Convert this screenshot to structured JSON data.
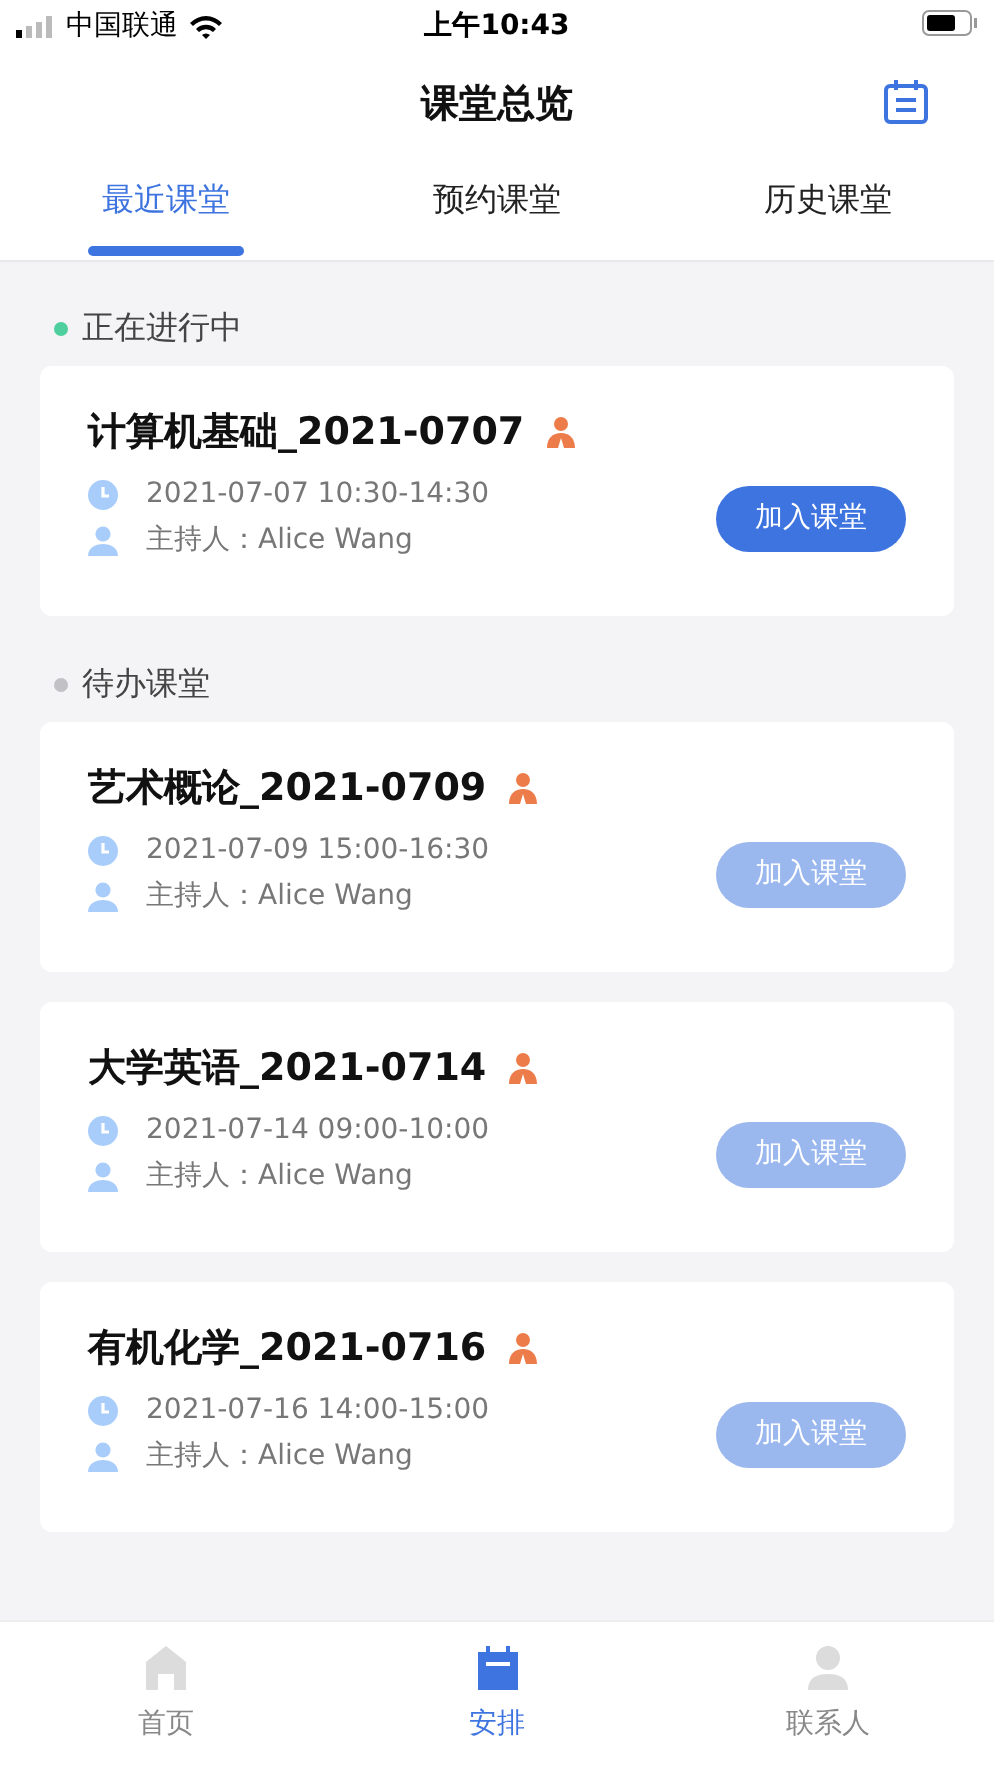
{
  "status_bar": {
    "carrier": "中国联通",
    "time": "上午10:43"
  },
  "header": {
    "title": "课堂总览"
  },
  "tabs": [
    {
      "label": "最近课堂",
      "selected": true
    },
    {
      "label": "预约课堂",
      "selected": false
    },
    {
      "label": "历史课堂",
      "selected": false
    }
  ],
  "sections": [
    {
      "title": "正在进行中",
      "color": "#4fcf9e",
      "classes": [
        {
          "name": "计算机基础_2021-0707",
          "time": "2021-07-07 10:30-14:30",
          "host": "主持人：Alice Wang",
          "button": "加入课堂",
          "disabled": false
        }
      ]
    },
    {
      "title": "待办课堂",
      "color": "#c2c2c6",
      "classes": [
        {
          "name": "艺术概论_2021-0709",
          "time": "2021-07-09 15:00-16:30",
          "host": "主持人：Alice Wang",
          "button": "加入课堂",
          "disabled": true
        },
        {
          "name": "大学英语_2021-0714",
          "time": "2021-07-14 09:00-10:00",
          "host": "主持人：Alice Wang",
          "button": "加入课堂",
          "disabled": true
        },
        {
          "name": "有机化学_2021-0716",
          "time": "2021-07-16 14:00-15:00",
          "host": "主持人：Alice Wang",
          "button": "加入课堂",
          "disabled": true
        }
      ]
    }
  ],
  "bottom_nav": [
    {
      "label": "首页",
      "kind": "home",
      "selected": false
    },
    {
      "label": "安排",
      "kind": "schedule",
      "selected": true
    },
    {
      "label": "联系人",
      "kind": "contacts",
      "selected": false
    }
  ]
}
